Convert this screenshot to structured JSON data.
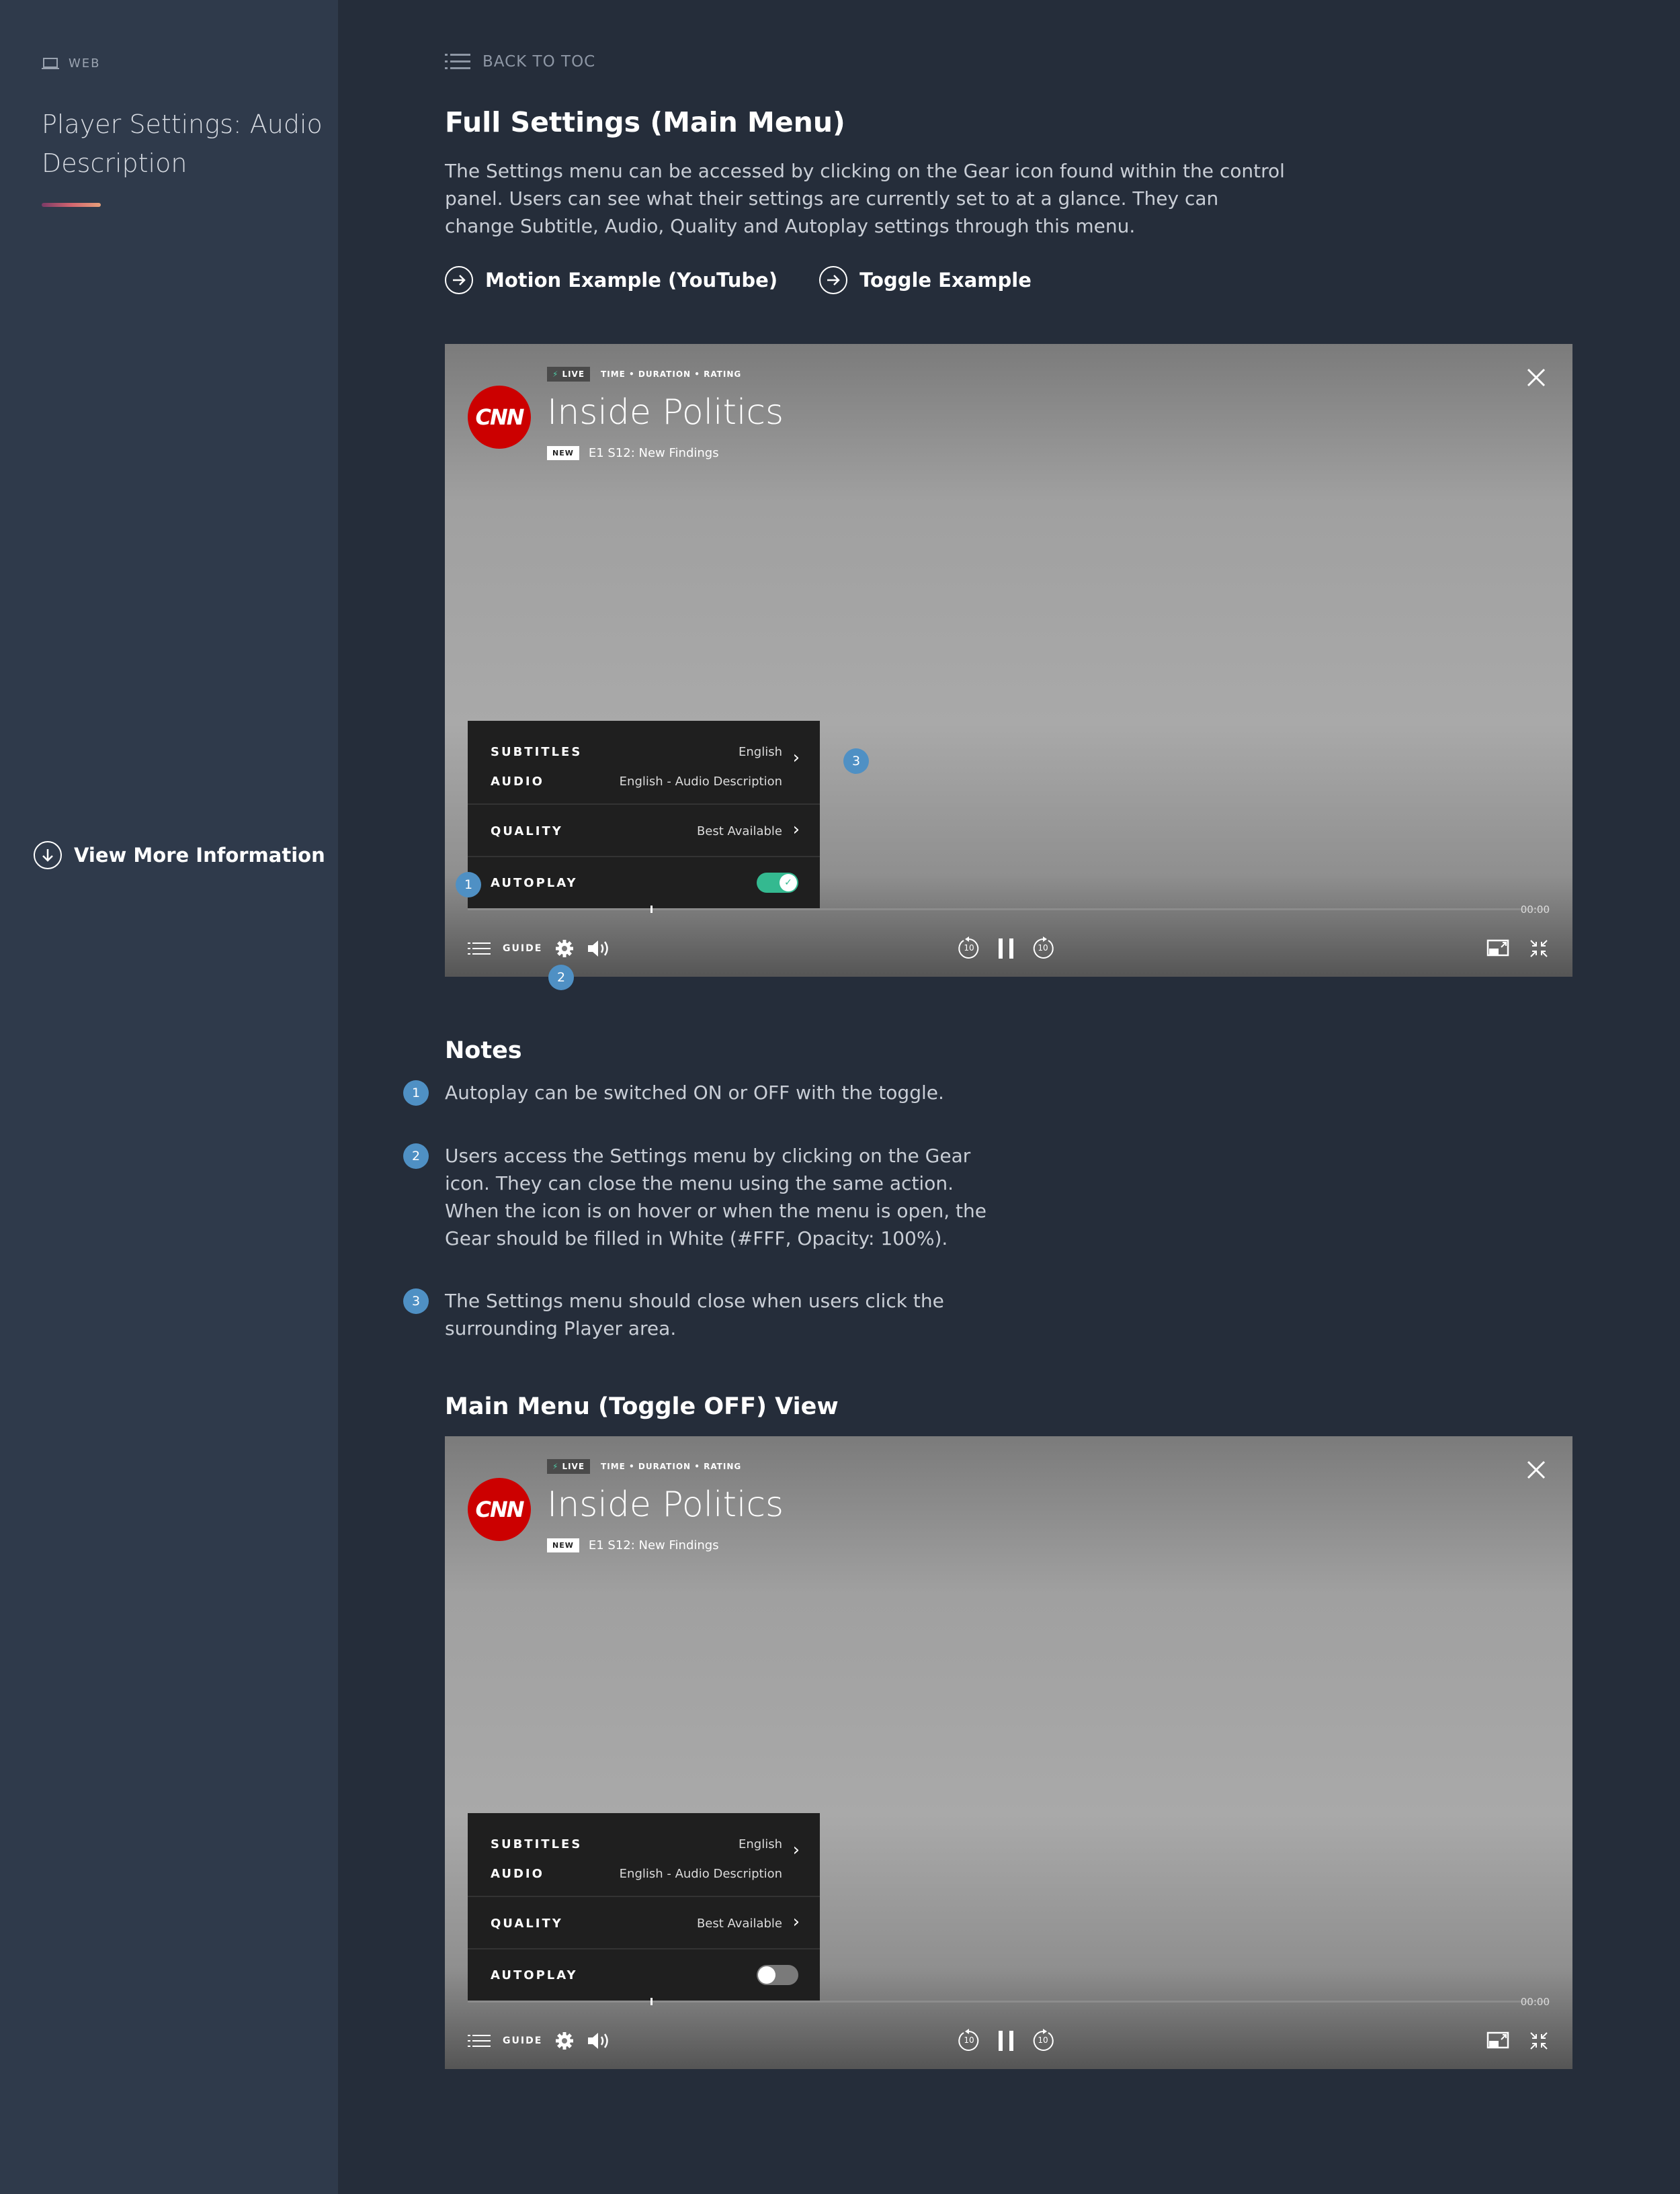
{
  "sidebar": {
    "platform_tag": "WEB",
    "title": "Player Settings: Audio Description",
    "view_more": "View More Information"
  },
  "header": {
    "back_link": "BACK TO TOC",
    "title": "Full Settings (Main Menu)",
    "description": "The Settings menu can be accessed by clicking on the Gear icon found within the control panel. Users can see what their settings are currently set to at a glance. They can change Subtitle, Audio, Quality and Autoplay settings through this menu.",
    "links": [
      "Motion Example (YouTube)",
      "Toggle Example"
    ]
  },
  "player": {
    "live_label": "LIVE",
    "meta": "TIME • DURATION • RATING",
    "logo_text": "CNN",
    "show_title": "Inside Politics",
    "new_badge": "NEW",
    "episode": "E1 S12: New Findings",
    "time": "00:00",
    "guide_label": "GUIDE",
    "menu": {
      "subtitles_label": "SUBTITLES",
      "subtitles_value": "English",
      "audio_label": "AUDIO",
      "audio_value": "English - Audio Description",
      "quality_label": "QUALITY",
      "quality_value": "Best Available",
      "autoplay_label": "AUTOPLAY"
    },
    "skip_back": "10",
    "skip_forward": "10"
  },
  "markers": [
    "1",
    "2",
    "3"
  ],
  "notes": {
    "title": "Notes",
    "items": [
      "Autoplay can be switched ON or OFF with the toggle.",
      "Users access the Settings menu by clicking on the Gear icon. They can close the menu using the same action. When the icon is on hover or when the menu is open, the Gear should be filled in White (#FFF, Opacity: 100%).",
      "The Settings menu should close when users click the surrounding Player area."
    ]
  },
  "section2": {
    "title": "Main Menu (Toggle OFF) View"
  },
  "colors": {
    "background": "#252d3a",
    "sidebar": "#2f3a4b",
    "marker": "#4f90c4",
    "toggle_on": "#34b990",
    "brand_red": "#cc0000"
  },
  "icons": [
    "laptop-icon",
    "list-icon",
    "arrow-right-circle-icon",
    "arrow-down-circle-icon",
    "close-icon",
    "gear-icon",
    "volume-icon",
    "rewind-10-icon",
    "pause-icon",
    "forward-10-icon",
    "picture-in-picture-icon",
    "minimize-icon",
    "chevron-right-icon",
    "check-icon",
    "bolt-icon"
  ]
}
